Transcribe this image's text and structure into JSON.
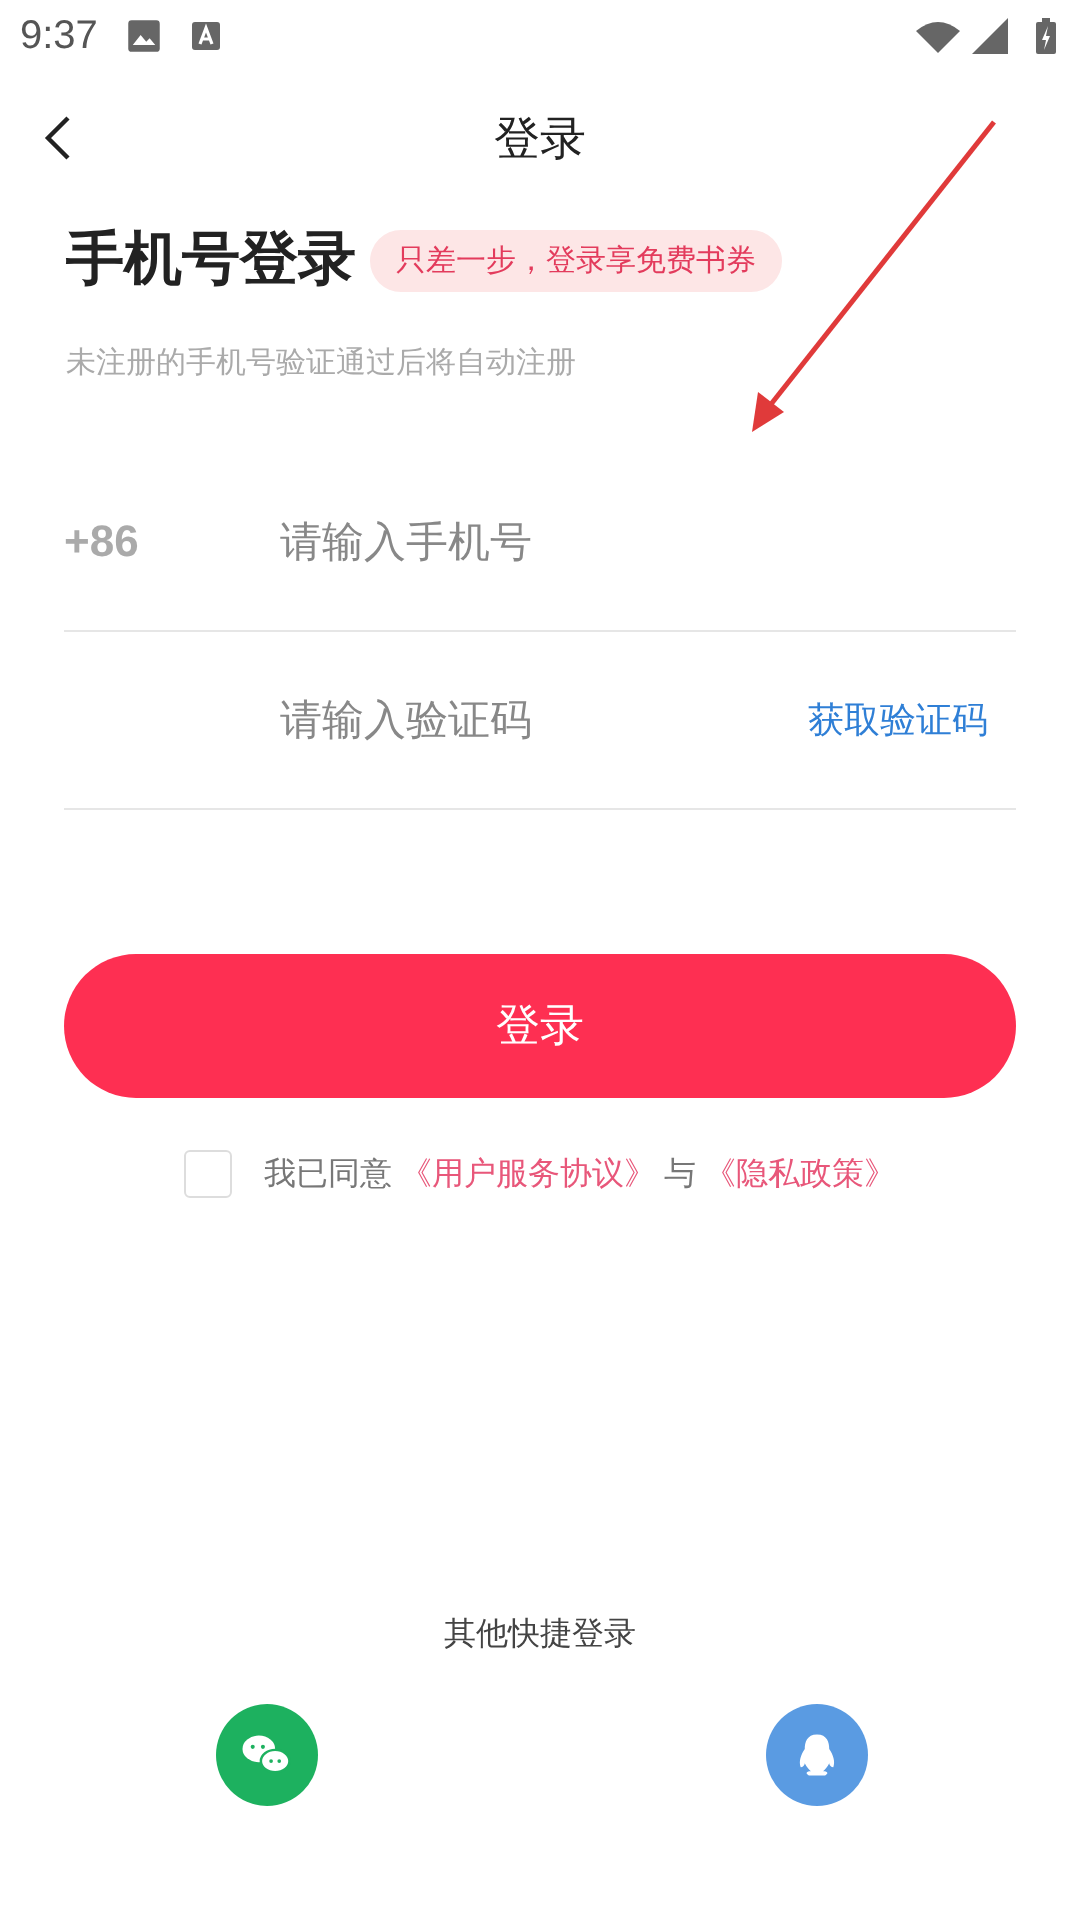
{
  "status_bar": {
    "time": "9:37"
  },
  "nav": {
    "title": "登录"
  },
  "heading": {
    "title": "手机号登录",
    "badge": "只差一步，登录享免费书券",
    "subtitle": "未注册的手机号验证通过后将自动注册"
  },
  "phone_field": {
    "prefix": "+86",
    "placeholder": "请输入手机号"
  },
  "code_field": {
    "placeholder": "请输入验证码",
    "action": "获取验证码"
  },
  "login_button": "登录",
  "agreement": {
    "checked": false,
    "prefix": "我已同意",
    "link_1": "《用户服务协议》",
    "joiner": "与",
    "link_2": "《隐私政策》"
  },
  "other_login": {
    "label": "其他快捷登录",
    "options": [
      {
        "kind": "wechat",
        "color": "#1db15f"
      },
      {
        "kind": "qq",
        "color": "#5a9be2"
      }
    ]
  }
}
